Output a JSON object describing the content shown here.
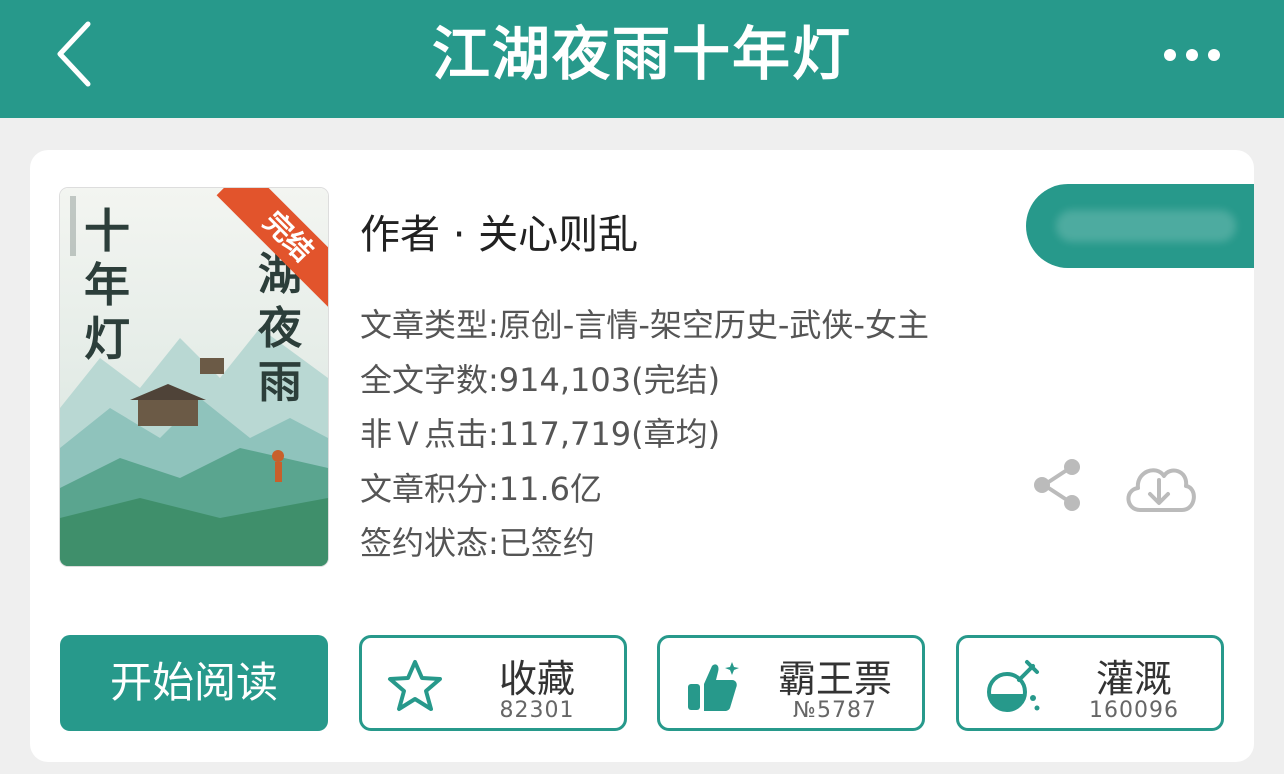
{
  "header": {
    "title": "江湖夜雨十年灯",
    "back_icon": "chevron-left-icon",
    "more_icon": "more-dots-icon"
  },
  "book": {
    "cover": {
      "ribbon": "完结",
      "title_left": "十年灯",
      "title_right": "湖夜雨"
    },
    "author_line": "作者 · 关心则乱",
    "details": [
      "文章类型:原创-言情-架空历史-武侠-女主",
      "全文字数:914,103(完结)",
      "非Ｖ点击:117,719(章均)",
      "文章积分:11.6亿",
      "签约状态:已签约"
    ]
  },
  "actions": {
    "read_label": "开始阅读",
    "collect": {
      "label": "收藏",
      "count": "82301",
      "icon": "star-icon"
    },
    "vote": {
      "label": "霸王票",
      "count": "№5787",
      "icon": "thumbs-up-icon"
    },
    "water": {
      "label": "灌溉",
      "count": "160096",
      "icon": "flask-icon"
    }
  },
  "icons": {
    "share": "share-icon",
    "download": "cloud-download-icon"
  },
  "colors": {
    "brand": "#27998b",
    "ribbon": "#e2542c",
    "background": "#efefef"
  }
}
